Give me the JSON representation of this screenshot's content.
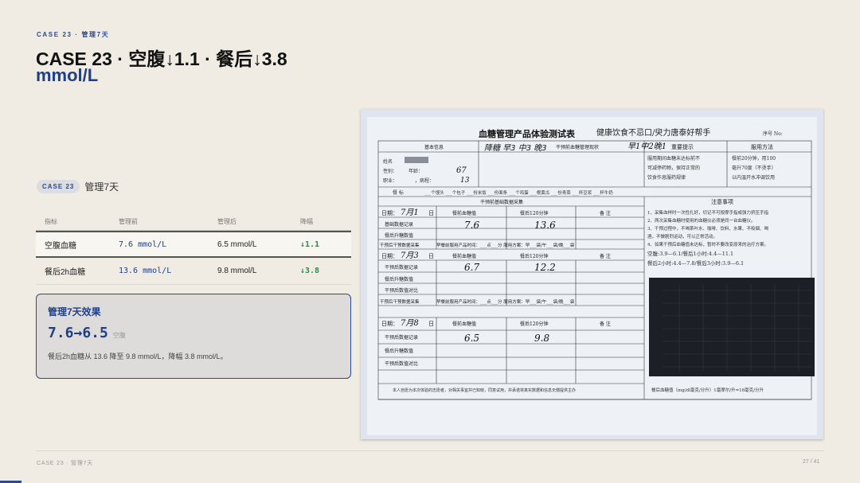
{
  "eyebrow": "CASE 23 · 管理7天",
  "title_line1": "CASE 23 · 空腹↓1.1 · 餐后↓3.8",
  "title_line2": "mmol/L",
  "case_pill": "CASE 23",
  "case_sub": "管理7天",
  "table": {
    "headers": [
      "指标",
      "管理前",
      "管理后",
      "降幅"
    ],
    "rows": [
      {
        "name": "空腹血糖",
        "before": "7.6 mmol/L",
        "after": "6.5 mmol/L",
        "drop": "↓1.1"
      },
      {
        "name": "餐后2h血糖",
        "before": "13.6 mmol/L",
        "after": "9.8 mmol/L",
        "drop": "↓3.8"
      }
    ]
  },
  "card": {
    "title": "管理7天效果",
    "big": "7.6→6.5",
    "big_label": "空腹",
    "text": "餐后2h血糖从 13.6 降至 9.8 mmol/L，降幅 3.8 mmol/L。"
  },
  "form": {
    "title": "血糖管理产品体验测试表",
    "slogan": "健康饮食不忌口/臾力唐泰好帮手",
    "serial": "序号 No:",
    "basic_info": "基本信息",
    "status": "干预前血糖管理现状",
    "hand_status": "早1中2晚1",
    "hand_name": "降糖 早3 中3 晚3",
    "tips_head": "重要提示",
    "method_head": "服用方法",
    "tips": [
      "服用期间血糖未达标前不",
      "可减停药物，保持正常的",
      "饮食作息服药规律"
    ],
    "method": [
      "餐前20分钟，用100",
      "毫升70度（不烫手）",
      "以内温开水冲调饮用"
    ],
    "left_labels": [
      "姓名",
      "性别：",
      "职业："
    ],
    "age": "年龄：",
    "age_val": "67",
    "years_val": "13",
    "disease": "，病程：",
    "diet": "餐  标",
    "diet_items": "___个馒头 ___个包子 ___份米饭 ___份面条 ___个鸡蛋 ___根黄瓜 ___份青菜 ___杯豆浆 ___杯牛奶",
    "collect_head": "干预前基础数据采集",
    "notes_head": "注意事项",
    "date": "日期：",
    "date1": "7月1",
    "date2": "7月3",
    "date3": "7月8",
    "day_unit": "日",
    "fasting": "餐前血糖值",
    "post120": "餐后120分钟",
    "remarks": "备  注",
    "basic_record": "基础数据记录",
    "after_record": "干预后数据记录",
    "rise": "餐后升糖数值",
    "compare": "干预后数值对比",
    "intervene": "干预后干预数据采集",
    "plan": "早餐前服用产品时间：___点___分  服用方案：早___袋/午___袋/晚___袋",
    "v1a": "7.6",
    "v1b": "13.6",
    "v2a": "6.7",
    "v2b": "12.2",
    "v3a": "6.5",
    "v3b": "9.8",
    "notes": [
      "1、采集血样时一次性扎好，切记不可按摩手指或强力挤压手指",
      "2、两次采集血糖时使用的血糖仪必须是同一台血糖仪。",
      "3、干预过程中，不喝茶叶水、咖啡、饮料、水果、不吸烟、喝",
      "酒，不做剧烈运动，可以正常活动。",
      "4、如果干预后血糖值未达标，暂时不要改变原来的治疗方案。"
    ],
    "ref1": "空腹:3.9—6.1/餐后1小时:4.4—11.1",
    "ref2": "餐后2小时:4.4—7.8/餐后3小时:3.9—6.1",
    "footer_left": "本人自愿为本次体验的志愿者，对相关事宜并已知晓，同意试用，并承诺将真实数据和信息无偿提供主办",
    "footer_right": "餐后血糖值（mg/dl毫克/分升）1毫摩尔/升=18毫克/分升"
  },
  "footer": {
    "left": "CASE 23 · 管理7天",
    "right": "27 / 41"
  }
}
